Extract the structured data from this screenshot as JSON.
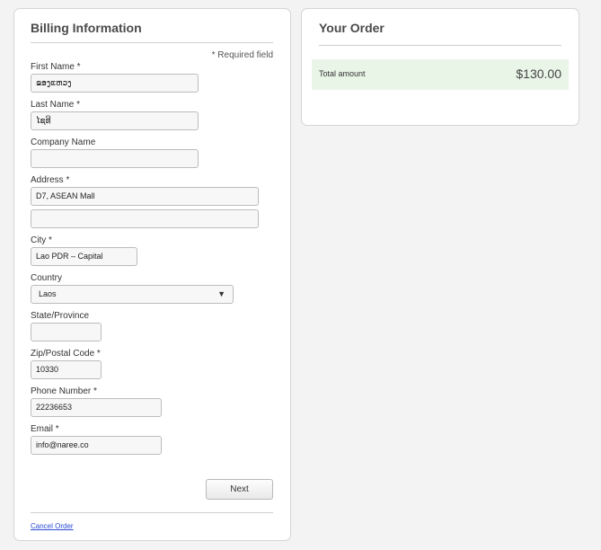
{
  "billing": {
    "title": "Billing Information",
    "required_note": "* Required field",
    "first_name": {
      "label": "First Name *",
      "value": "ຂອງແຫວງ"
    },
    "last_name": {
      "label": "Last Name *",
      "value": "ໄຊທີ"
    },
    "company": {
      "label": "Company Name",
      "value": ""
    },
    "address": {
      "label": "Address *",
      "value": "D7, ASEAN Mall",
      "value2": ""
    },
    "city": {
      "label": "City *",
      "value": "Lao PDR –  Capital"
    },
    "country": {
      "label": "Country",
      "value": "Laos"
    },
    "state": {
      "label": "State/Province",
      "value": ""
    },
    "zip": {
      "label": "Zip/Postal Code *",
      "value": "10330"
    },
    "phone": {
      "label": "Phone Number *",
      "value": "22236653"
    },
    "email": {
      "label": "Email *",
      "value": "info@naree.co"
    },
    "next_label": "Next",
    "cancel_label": "Cancel Order"
  },
  "order": {
    "title": "Your Order",
    "total_label": "Total amount",
    "total_value": "$130.00"
  },
  "colors": {
    "background": "#f3f3f3",
    "total_bar": "#e9f5e7",
    "link": "#2a4bd6"
  }
}
